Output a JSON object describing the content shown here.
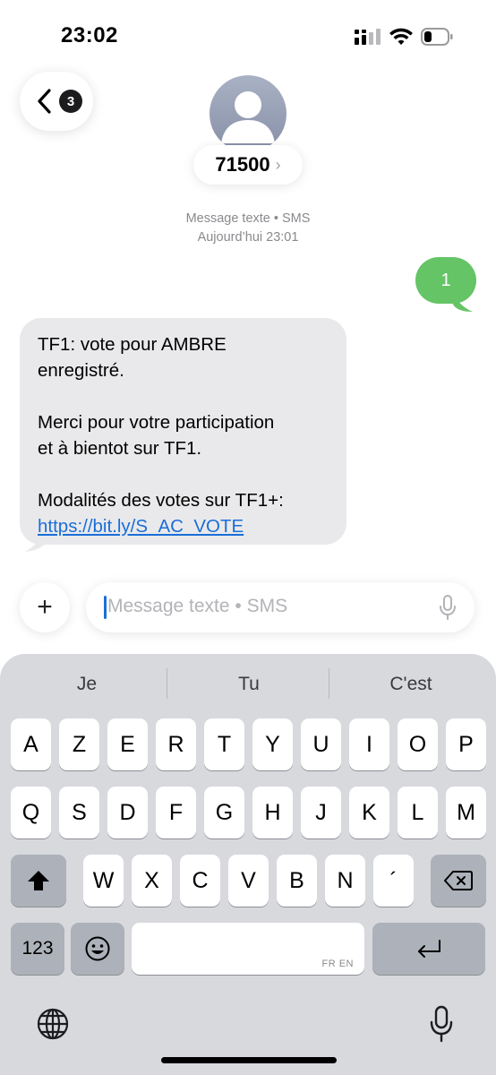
{
  "status_bar": {
    "time": "23:02"
  },
  "header": {
    "back_badge": "3",
    "contact_name": "71500",
    "contact_chevron": "›"
  },
  "meta": {
    "line1": "Message texte • SMS",
    "line2": "Aujourd’hui 23:01"
  },
  "messages": {
    "sent": {
      "text": "1",
      "color": "#65c466"
    },
    "received": {
      "line1": "TF1: vote pour AMBRE",
      "line2": "enregistré.",
      "line3": "Merci pour votre participation",
      "line4": "et à bientot sur TF1.",
      "line5": "Modalités des votes sur TF1+:",
      "link": "https://bit.ly/S_AC_VOTE",
      "color": "#e9e9eb"
    }
  },
  "composer": {
    "plus_label": "+",
    "placeholder": "Message texte • SMS"
  },
  "keyboard": {
    "suggestions": [
      "Je",
      "Tu",
      "C'est"
    ],
    "row1": [
      "A",
      "Z",
      "E",
      "R",
      "T",
      "Y",
      "U",
      "I",
      "O",
      "P"
    ],
    "row2": [
      "Q",
      "S",
      "D",
      "F",
      "G",
      "H",
      "J",
      "K",
      "L",
      "M"
    ],
    "row3": [
      "W",
      "X",
      "C",
      "V",
      "B",
      "N",
      "´"
    ],
    "numbers_label": "123",
    "space_lang": "FR EN",
    "icons": [
      "shift-icon",
      "delete-icon",
      "emoji-icon",
      "return-icon",
      "globe-icon",
      "dictation-mic-icon"
    ]
  }
}
